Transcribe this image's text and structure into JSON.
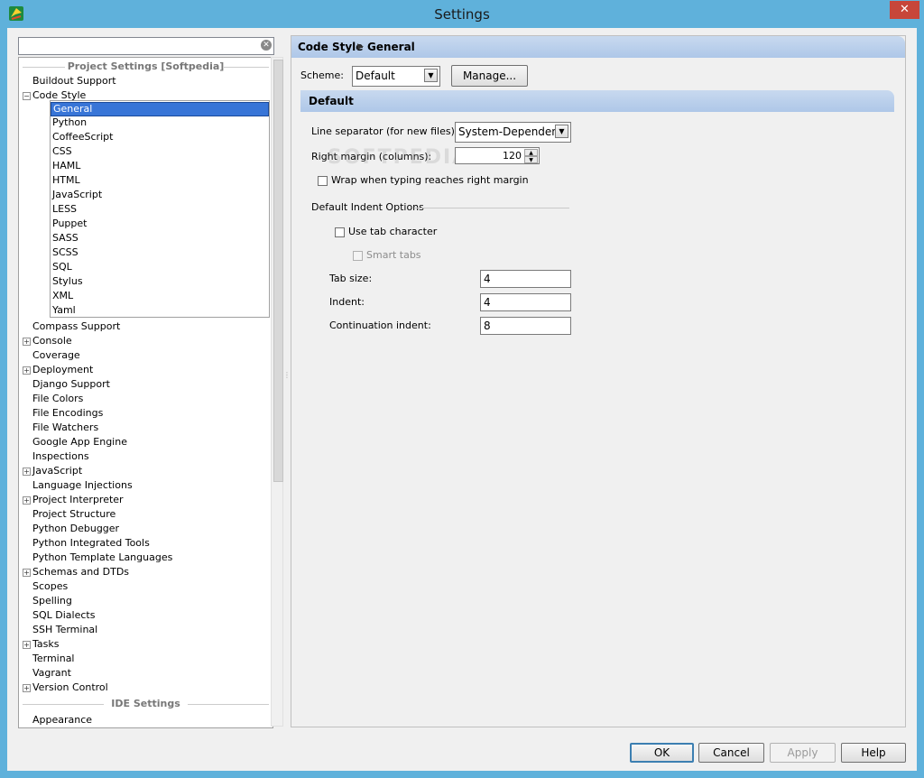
{
  "window": {
    "title": "Settings",
    "close_glyph": "✕"
  },
  "search": {
    "value": "",
    "clear_glyph": "✕"
  },
  "tree": {
    "project_header": "Project Settings [Softpedia]",
    "ide_header": "IDE Settings",
    "items": [
      {
        "label": "Buildout Support",
        "expander": ""
      },
      {
        "label": "Code Style",
        "expander": "−"
      },
      {
        "label": "Compass Support",
        "expander": ""
      },
      {
        "label": "Console",
        "expander": "+"
      },
      {
        "label": "Coverage",
        "expander": ""
      },
      {
        "label": "Deployment",
        "expander": "+"
      },
      {
        "label": "Django Support",
        "expander": ""
      },
      {
        "label": "File Colors",
        "expander": ""
      },
      {
        "label": "File Encodings",
        "expander": ""
      },
      {
        "label": "File Watchers",
        "expander": ""
      },
      {
        "label": "Google App Engine",
        "expander": ""
      },
      {
        "label": "Inspections",
        "expander": ""
      },
      {
        "label": "JavaScript",
        "expander": "+"
      },
      {
        "label": "Language Injections",
        "expander": ""
      },
      {
        "label": "Project Interpreter",
        "expander": "+"
      },
      {
        "label": "Project Structure",
        "expander": ""
      },
      {
        "label": "Python Debugger",
        "expander": ""
      },
      {
        "label": "Python Integrated Tools",
        "expander": ""
      },
      {
        "label": "Python Template Languages",
        "expander": ""
      },
      {
        "label": "Schemas and DTDs",
        "expander": "+"
      },
      {
        "label": "Scopes",
        "expander": ""
      },
      {
        "label": "Spelling",
        "expander": ""
      },
      {
        "label": "SQL Dialects",
        "expander": ""
      },
      {
        "label": "SSH Terminal",
        "expander": ""
      },
      {
        "label": "Tasks",
        "expander": "+"
      },
      {
        "label": "Terminal",
        "expander": ""
      },
      {
        "label": "Vagrant",
        "expander": ""
      },
      {
        "label": "Version Control",
        "expander": "+"
      }
    ],
    "code_style_children": [
      "General",
      "Python",
      "CoffeeScript",
      "CSS",
      "HAML",
      "HTML",
      "JavaScript",
      "LESS",
      "Puppet",
      "SASS",
      "SCSS",
      "SQL",
      "Stylus",
      "XML",
      "Yaml"
    ],
    "ide_items": [
      "Appearance"
    ],
    "selected": "General"
  },
  "panel": {
    "breadcrumb_1": "Code Style",
    "breadcrumb_sep": "▶",
    "breadcrumb_2": "General",
    "scheme_label": "Scheme:",
    "scheme_value": "Default",
    "manage_button": "Manage...",
    "section_title": "Default",
    "line_separator_label": "Line separator (for new files):",
    "line_separator_value": "System-Dependent",
    "right_margin_label": "Right margin (columns):",
    "right_margin_value": "120",
    "wrap_label": "Wrap when typing reaches right margin",
    "wrap_checked": false,
    "indent_group_label": "Default Indent Options",
    "use_tab_label": "Use tab character",
    "use_tab_checked": false,
    "smart_tabs_label": "Smart tabs",
    "smart_tabs_checked": false,
    "tab_size_label": "Tab size:",
    "tab_size_value": "4",
    "indent_label": "Indent:",
    "indent_value": "4",
    "continuation_label": "Continuation indent:",
    "continuation_value": "8",
    "watermark": "SOFTPEDIA"
  },
  "buttons": {
    "ok": "OK",
    "cancel": "Cancel",
    "apply": "Apply",
    "help": "Help"
  },
  "colors": {
    "accent": "#3875d7",
    "window_frame": "#5fb1db",
    "header_bar": "#aec7e8",
    "close": "#c7463a"
  }
}
